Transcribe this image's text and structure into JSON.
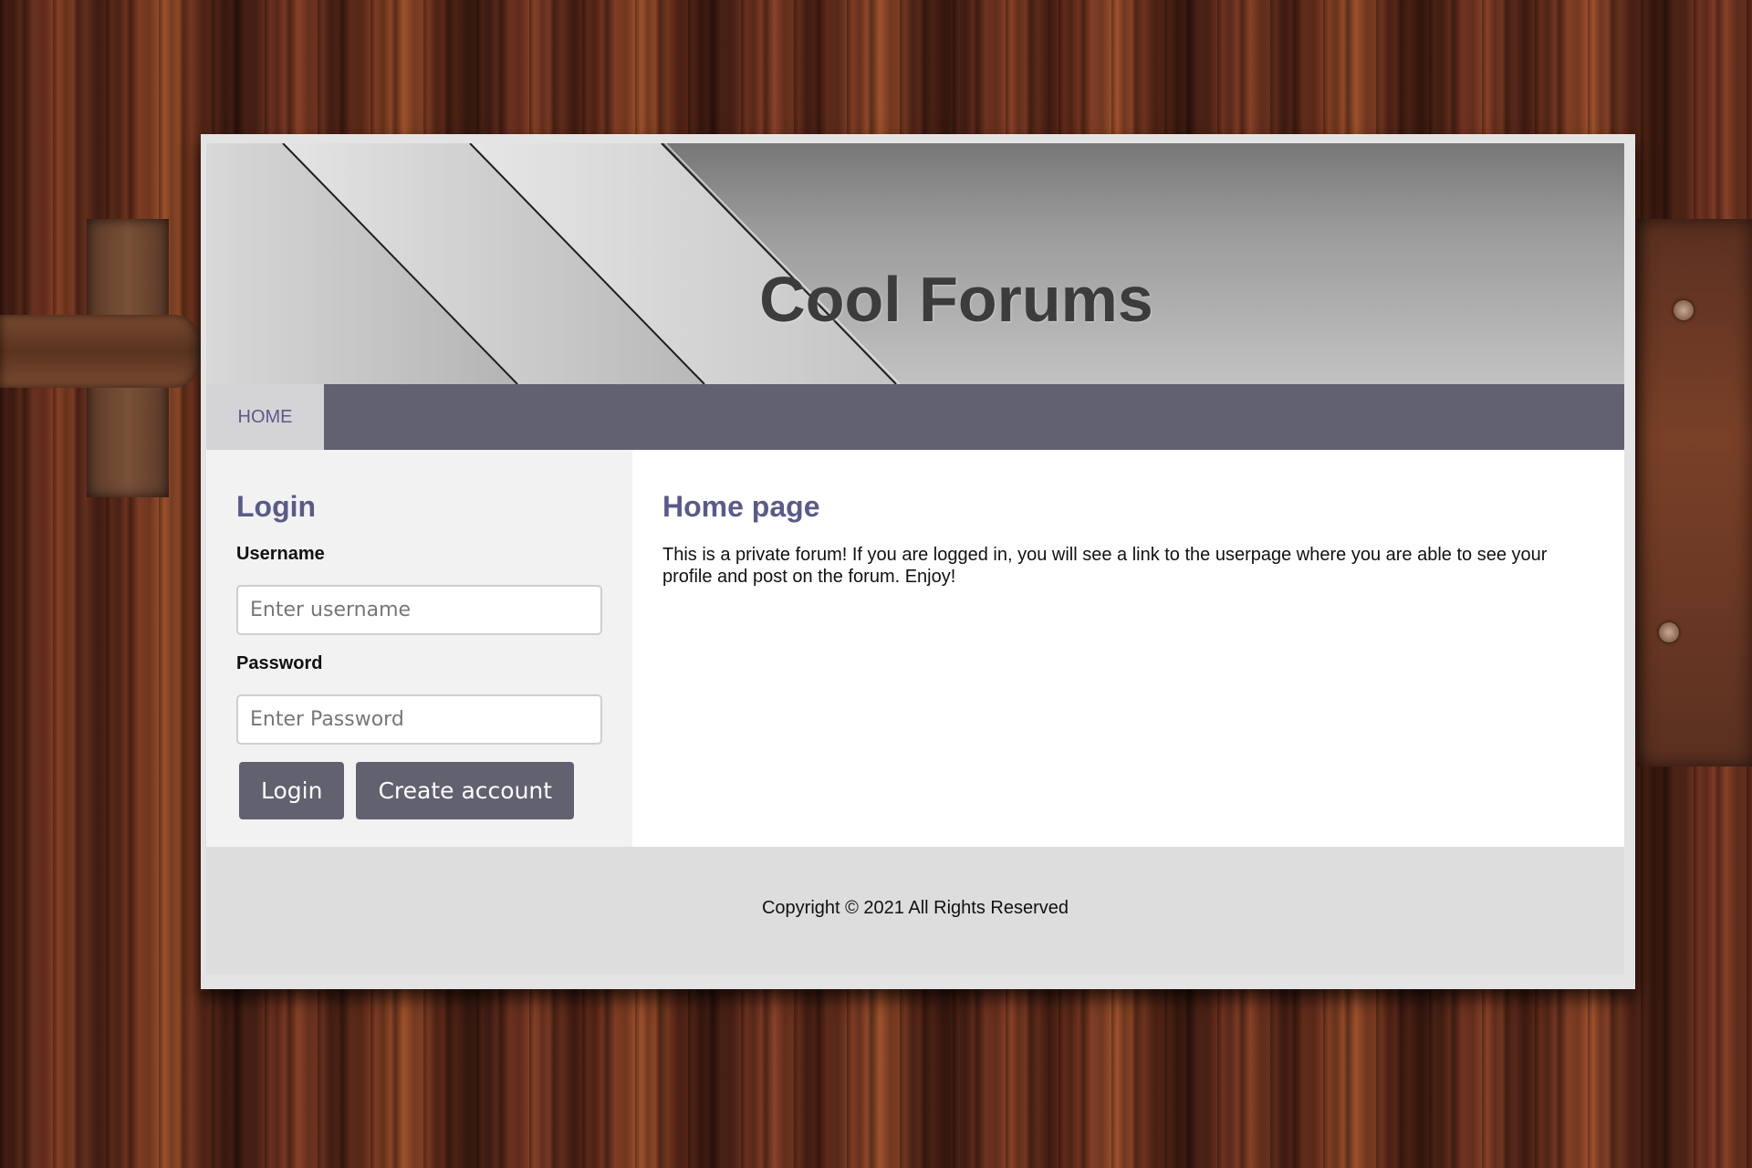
{
  "site": {
    "title": "Cool Forums"
  },
  "nav": {
    "items": [
      {
        "label": "HOME"
      }
    ]
  },
  "login": {
    "heading": "Login",
    "username_label": "Username",
    "username_placeholder": "Enter username",
    "password_label": "Password",
    "password_placeholder": "Enter Password",
    "login_button": "Login",
    "create_button": "Create account"
  },
  "main": {
    "heading": "Home page",
    "body": "This is a private forum! If you are logged in, you will see a link to the userpage where you are able to see your profile and post on the forum. Enjoy!"
  },
  "footer": {
    "text": "Copyright © 2021 All Rights Reserved"
  },
  "colors": {
    "accent": "#626170",
    "heading": "#5a5a8a",
    "sidebar_bg": "#f2f2f2",
    "footer_bg": "#dddddd"
  }
}
